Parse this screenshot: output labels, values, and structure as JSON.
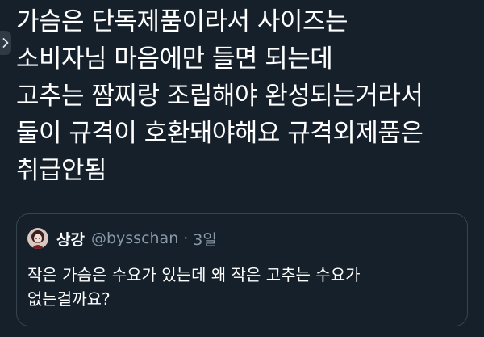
{
  "tweet": {
    "lines": [
      "가슴은 단독제품이라서 사이즈는",
      "소비자님 마음에만 들면 되는데",
      "고추는 짬찌랑 조립해야 완성되는거라서",
      "둘이 규격이 호환돼야해요 규격외제품은",
      "취급안됨"
    ]
  },
  "quoted_tweet": {
    "display_name": "상강",
    "handle": "@bysschan",
    "separator": "·",
    "time": "3일",
    "lines": [
      "작은 가슴은 수요가 있는데 왜 작은 고추는 수요가",
      "없는걸까요?"
    ]
  },
  "icons": {
    "collapse": "chevron-right-icon"
  },
  "colors": {
    "background": "#15202b",
    "text": "#ffffff",
    "secondary_text": "#8899a6",
    "border": "#38444d"
  }
}
